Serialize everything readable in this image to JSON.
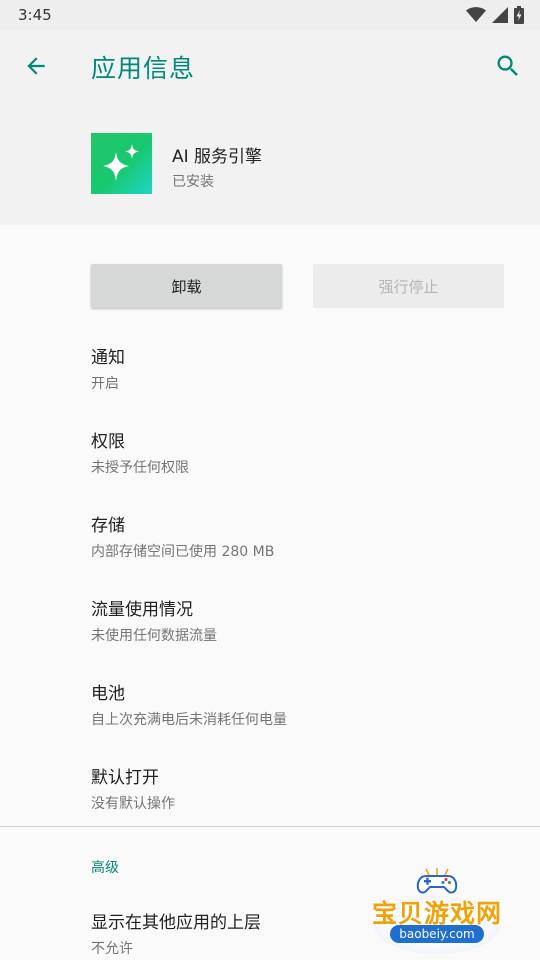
{
  "status_bar": {
    "time": "3:45",
    "icons": [
      "wifi-icon",
      "signal-icon",
      "battery-charging-icon"
    ]
  },
  "toolbar": {
    "title": "应用信息",
    "back_icon": "arrow-back-icon",
    "search_icon": "search-icon",
    "accent_color": "#00897b"
  },
  "app": {
    "name": "AI 服务引擎",
    "status": "已安装",
    "icon": "sparkles-icon"
  },
  "buttons": {
    "uninstall": "卸载",
    "force_stop": "强行停止"
  },
  "list": [
    {
      "title": "通知",
      "summary": "开启"
    },
    {
      "title": "权限",
      "summary": "未授予任何权限"
    },
    {
      "title": "存储",
      "summary": "内部存储空间已使用 280 MB"
    },
    {
      "title": "流量使用情况",
      "summary": "未使用任何数据流量"
    },
    {
      "title": "电池",
      "summary": "自上次充满电后未消耗任何电量"
    },
    {
      "title": "默认打开",
      "summary": "没有默认操作"
    }
  ],
  "advanced": {
    "section_title": "高级",
    "items": [
      {
        "title": "显示在其他应用的上层",
        "summary": "不允许"
      }
    ]
  },
  "watermark": {
    "text": "宝贝游戏网",
    "url": "baobeiy.com"
  }
}
